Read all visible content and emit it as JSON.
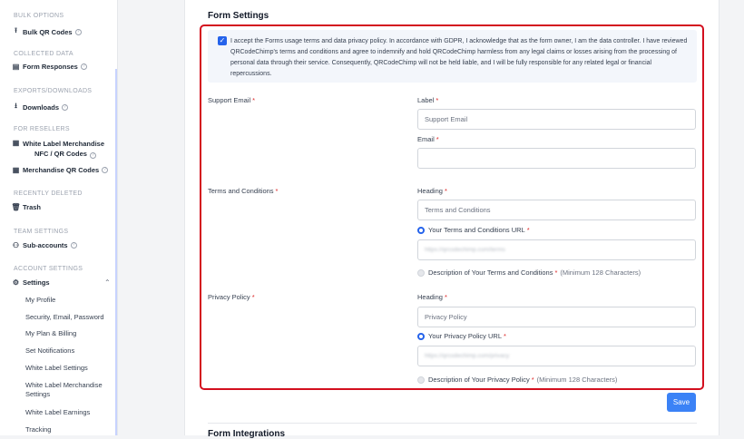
{
  "sidebar": {
    "sections": [
      {
        "label": "BULK OPTIONS"
      },
      {
        "label": "COLLECTED DATA"
      },
      {
        "label": "EXPORTS/DOWNLOADS"
      },
      {
        "label": "FOR RESELLERS"
      },
      {
        "label": "RECENTLY DELETED"
      },
      {
        "label": "TEAM SETTINGS"
      },
      {
        "label": "ACCOUNT SETTINGS"
      }
    ],
    "items": [
      {
        "label": "Bulk QR Codes",
        "icon": "upload-icon"
      },
      {
        "label": "Form Responses",
        "icon": "table-icon"
      },
      {
        "label": "Downloads",
        "icon": "download-icon"
      },
      {
        "label": "White Label Merchandise NFC / QR Codes",
        "line1": "White Label Merchandise",
        "line2": "NFC / QR Codes",
        "icon": "grid-icon"
      },
      {
        "label": "Merchandise QR Codes",
        "icon": "grid-icon"
      },
      {
        "label": "Trash",
        "icon": "trash-icon"
      },
      {
        "label": "Sub-accounts",
        "icon": "user-icon"
      },
      {
        "label": "Settings",
        "icon": "gear-icon"
      }
    ],
    "settings_sub": [
      {
        "label": "My Profile"
      },
      {
        "label": "Security, Email, Password"
      },
      {
        "label": "My Plan & Billing"
      },
      {
        "label": "Set Notifications"
      },
      {
        "label": "White Label Settings"
      },
      {
        "label": "White Label Merchandise Settings"
      },
      {
        "label": "White Label Earnings"
      },
      {
        "label": "Tracking"
      }
    ]
  },
  "form": {
    "title": "Form Settings",
    "consent": {
      "checked": true,
      "text": "I accept the Forms usage terms and data privacy policy. In accordance with GDPR, I acknowledge that as the form owner, I am the data controller. I have reviewed QRCodeChimp's terms and conditions and agree to indemnify and hold QRCodeChimp harmless from any legal claims or losses arising from the processing of personal data through their service. Consequently, QRCodeChimp will not be held liable, and I will be fully responsible for any related legal or financial repercussions."
    },
    "support": {
      "section_label": "Support Email",
      "label_field_label": "Label",
      "label_value": "Support Email",
      "email_field_label": "Email",
      "email_value": ""
    },
    "terms": {
      "section_label": "Terms and Conditions",
      "heading_label": "Heading",
      "heading_value": "Terms and Conditions",
      "url_option_label": "Your Terms and Conditions URL",
      "url_value": "https://qrcodechimp.com/terms",
      "desc_option_label": "Description of Your Terms and Conditions",
      "desc_hint": "(Minimum 128 Characters)"
    },
    "privacy": {
      "section_label": "Privacy Policy",
      "heading_label": "Heading",
      "heading_value": "Privacy Policy",
      "url_option_label": "Your Privacy Policy URL",
      "url_value": "https://qrcodechimp.com/privacy",
      "desc_option_label": "Description of Your Privacy Policy",
      "desc_hint": "(Minimum 128 Characters)"
    },
    "save_label": "Save",
    "required_mark": "*"
  },
  "next_section_title": "Form Integrations",
  "colors": {
    "accent": "#2563eb",
    "highlight_border": "#d30f1e",
    "save_button": "#3b82f6"
  }
}
